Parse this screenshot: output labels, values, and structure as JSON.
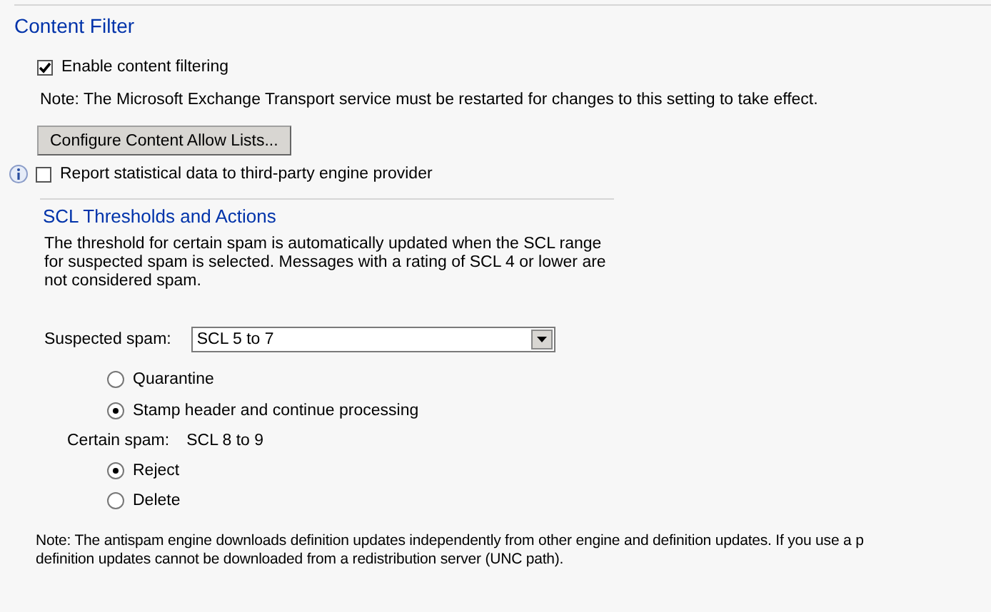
{
  "title": "Content Filter",
  "enable": {
    "label": "Enable content filtering",
    "checked": true
  },
  "restart_note": "Note: The Microsoft Exchange Transport service must be restarted for changes to this setting to take effect.",
  "configure_button": "Configure Content Allow Lists...",
  "report": {
    "label": "Report statistical data to third-party engine provider",
    "checked": false
  },
  "scl": {
    "title": "SCL Thresholds and Actions",
    "description": "The threshold for certain spam is automatically updated when the SCL range for suspected spam is selected. Messages with a rating of SCL 4 or lower are not considered spam.",
    "suspected_label": "Suspected spam:",
    "suspected_value": "SCL 5 to 7",
    "suspected_actions": [
      {
        "label": "Quarantine",
        "selected": false
      },
      {
        "label": "Stamp header and continue processing",
        "selected": true
      }
    ],
    "certain_label": "Certain spam:",
    "certain_value": "SCL 8 to 9",
    "certain_actions": [
      {
        "label": "Reject",
        "selected": true
      },
      {
        "label": "Delete",
        "selected": false
      }
    ]
  },
  "footer_note": [
    "Note: The antispam engine downloads definition updates independently from other engine and definition updates. If you use a p",
    "definition updates cannot be downloaded from a redistribution server (UNC path)."
  ]
}
